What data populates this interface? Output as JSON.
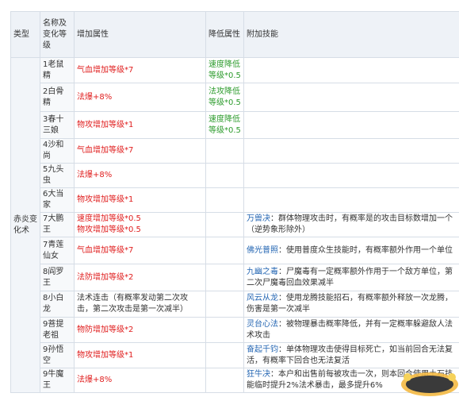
{
  "headers": {
    "type": "类型",
    "name": "名称及变化等级",
    "add": "增加属性",
    "reduce": "降低属性",
    "skill": "附加技能"
  },
  "category": "赤炎变化术",
  "rows": [
    {
      "name": "1老鼠精",
      "add": [
        "气血增加等级*7"
      ],
      "reduce": "速度降低等级*0.5",
      "skill_name": "",
      "skill_desc": ""
    },
    {
      "name": "2白骨精",
      "add": [
        "法爆+8%"
      ],
      "reduce": "法攻降低等级*0.5",
      "skill_name": "",
      "skill_desc": ""
    },
    {
      "name": "3春十三娘",
      "add": [
        "物攻增加等级*1"
      ],
      "reduce": "速度降低等级*0.5",
      "skill_name": "",
      "skill_desc": ""
    },
    {
      "name": "4沙和尚",
      "add": [
        "气血增加等级*7"
      ],
      "reduce": "",
      "skill_name": "",
      "skill_desc": ""
    },
    {
      "name": "5九头虫",
      "add": [
        "法爆+8%"
      ],
      "reduce": "",
      "skill_name": "",
      "skill_desc": ""
    },
    {
      "name": "6大当家",
      "add": [
        "物攻增加等级*1"
      ],
      "reduce": "",
      "skill_name": "",
      "skill_desc": ""
    },
    {
      "name": "7大鹏王",
      "add": [
        "速度增加等级*0.5",
        "物攻增加等级*0.5"
      ],
      "reduce": "",
      "skill_name": "万兽决",
      "skill_desc": "：群体物理攻击时，有概率是的攻击目标数增加一个（逆势象形除外）"
    },
    {
      "name": "7青莲仙女",
      "add": [
        "气血增加等级*7"
      ],
      "reduce": "",
      "skill_name": "佛光普照",
      "skill_desc": "：使用普度众生技能时，有概率额外作用一个单位"
    },
    {
      "name": "8阎罗王",
      "add": [
        "法防增加等级*2"
      ],
      "reduce": "",
      "skill_name": "九幽之毒",
      "skill_desc": "：尸魔毒有一定概率额外作用于一个敌方单位，第二次尸魔毒回血效果减半"
    },
    {
      "name": "8小白龙",
      "add": [
        "法术连击（有概率发动第二次攻击，第二次攻击是第一次减半）"
      ],
      "reduce": "",
      "skill_name": "风云从龙",
      "skill_desc": "：使用龙腾技能招石，有概率额外释放一次龙腾，伤害是第一次减半"
    },
    {
      "name": "9菩提老祖",
      "add": [
        "物防增加等级*2"
      ],
      "reduce": "",
      "skill_name": "灵台心法",
      "skill_desc": "：被物理暴击概率降低，并有一定概率躲避敌人法术攻击"
    },
    {
      "name": "9孙悟空",
      "add": [
        "物攻增加等级*1"
      ],
      "reduce": "",
      "skill_name": "奋起千钧",
      "skill_desc": "：单体物理攻击使得目标死亡，如当前回合无法复活，有概率下回合也无法复活"
    },
    {
      "name": "9牛魔王",
      "add": [
        "法爆+8%"
      ],
      "reduce": "",
      "skill_name": "狂牛决",
      "skill_desc": "：本户和出售前每被攻击一次，则本回合使用土石技能临时提升2%法术暴击，最多提升6%"
    }
  ],
  "watermark": {
    "text": "18183"
  },
  "colors": {
    "add": "#e02020",
    "reduce": "#2e9c2e",
    "skill_name": "#2466b3",
    "border": "#d6dde6",
    "header_bg": "#eef2f7"
  }
}
